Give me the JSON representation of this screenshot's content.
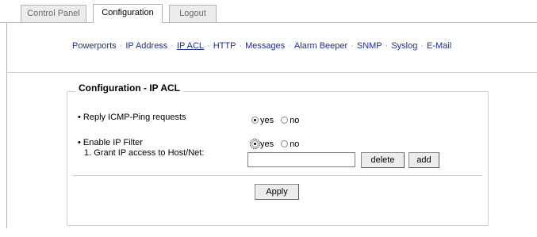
{
  "tabs": [
    {
      "label": "Control Panel",
      "active": false
    },
    {
      "label": "Configuration",
      "active": true
    },
    {
      "label": "Logout",
      "active": false
    }
  ],
  "subnav": {
    "items": [
      "Powerports",
      "IP Address",
      "IP ACL",
      "HTTP",
      "Messages",
      "Alarm Beeper",
      "SNMP",
      "Syslog",
      "E-Mail"
    ],
    "current": "IP ACL",
    "separator": "·"
  },
  "panel": {
    "title": "Configuration - IP ACL",
    "icmp": {
      "label": "• Reply ICMP-Ping requests",
      "yes": "yes",
      "no": "no",
      "selected": "yes"
    },
    "ipfilter": {
      "label": "• Enable IP Filter",
      "yes": "yes",
      "no": "no",
      "selected": "yes"
    },
    "grant": {
      "label": "1. Grant IP access to Host/Net:",
      "value": "",
      "delete_label": "delete",
      "add_label": "add"
    },
    "apply_label": "Apply"
  }
}
